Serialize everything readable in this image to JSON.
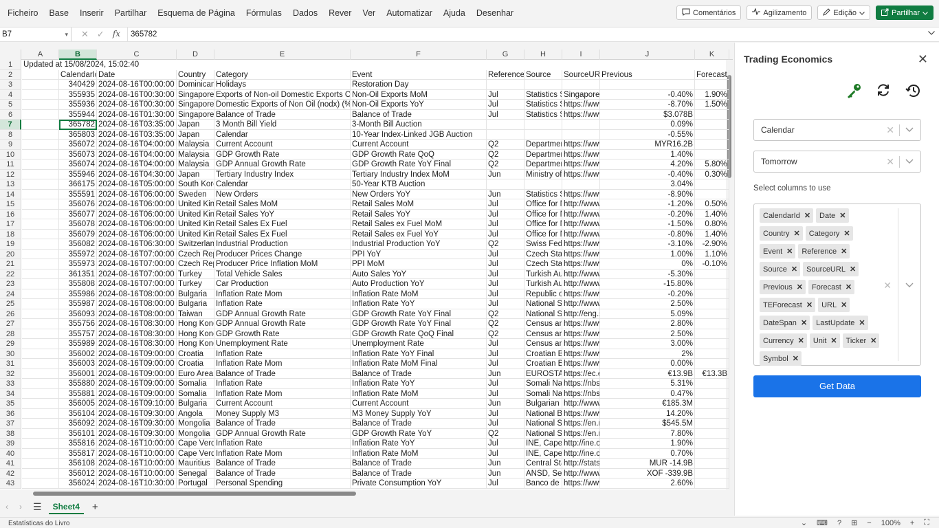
{
  "menu": [
    "Ficheiro",
    "Base",
    "Inserir",
    "Partilhar",
    "Esquema de Página",
    "Fórmulas",
    "Dados",
    "Rever",
    "Ver",
    "Automatizar",
    "Ajuda",
    "Desenhar"
  ],
  "toolbar": {
    "comments": "Comentários",
    "catchup": "Agilizamento",
    "editing": "Edição",
    "share": "Partilhar"
  },
  "formula": {
    "namebox": "B7",
    "value": "365782"
  },
  "columns": [
    "A",
    "B",
    "C",
    "D",
    "E",
    "F",
    "G",
    "H",
    "I",
    "J",
    "K"
  ],
  "title_row": "Updated at 15/08/2024, 15:02:40",
  "header_row": [
    "",
    "CalendarId",
    "Date",
    "Country",
    "Category",
    "Event",
    "Reference",
    "Source",
    "SourceURL",
    "Previous",
    "Forecast"
  ],
  "rows": [
    [
      "340429",
      "2024-08-16T00:00:00",
      "Dominican Republic",
      "Holidays",
      "Restoration Day",
      "",
      "",
      "",
      "",
      ""
    ],
    [
      "355935",
      "2024-08-16T00:30:00",
      "Singapore",
      "Exports of Non-oil Domestic Exports Oil",
      "Non-Oil Exports MoM",
      "Jul",
      "Statistics Singapore",
      "Singapore",
      "-0.40%",
      "1.90%"
    ],
    [
      "355936",
      "2024-08-16T00:30:00",
      "Singapore",
      "Domestic Exports of Non Oil (nodx) (% YoY)",
      "Non-Oil Exports YoY",
      "Jul",
      "Statistics Singapore",
      "https://www",
      "-8.70%",
      "1.50%"
    ],
    [
      "355944",
      "2024-08-16T01:30:00",
      "Singapore",
      "Balance of Trade",
      "Balance of Trade",
      "Jul",
      "Statistics Singapore",
      "https://www",
      "$3.078B",
      ""
    ],
    [
      "365782",
      "2024-08-16T03:35:00",
      "Japan",
      "3 Month Bill Yield",
      "3-Month Bill Auction",
      "",
      "",
      "",
      "0.09%",
      ""
    ],
    [
      "365803",
      "2024-08-16T03:35:00",
      "Japan",
      "Calendar",
      "10-Year Index-Linked JGB Auction",
      "",
      "",
      "",
      "-0.55%",
      ""
    ],
    [
      "356072",
      "2024-08-16T04:00:00",
      "Malaysia",
      "Current Account",
      "Current Account",
      "Q2",
      "Department",
      "https://www",
      "MYR16.2B",
      ""
    ],
    [
      "356073",
      "2024-08-16T04:00:00",
      "Malaysia",
      "GDP Growth Rate",
      "GDP Growth Rate QoQ",
      "Q2",
      "Department",
      "https://www",
      "1.40%",
      ""
    ],
    [
      "356074",
      "2024-08-16T04:00:00",
      "Malaysia",
      "GDP Annual Growth Rate",
      "GDP Growth Rate YoY Final",
      "Q2",
      "Department",
      "https://www",
      "4.20%",
      "5.80%"
    ],
    [
      "355946",
      "2024-08-16T04:30:00",
      "Japan",
      "Tertiary Industry Index",
      "Tertiary Industry Index MoM",
      "Jun",
      "Ministry of",
      "https://www",
      "-0.40%",
      "0.30%"
    ],
    [
      "366175",
      "2024-08-16T05:00:00",
      "South Korea",
      "Calendar",
      "50-Year KTB Auction",
      "",
      "",
      "",
      "3.04%",
      ""
    ],
    [
      "355591",
      "2024-08-16T06:00:00",
      "Sweden",
      "New Orders",
      "New Orders YoY",
      "Jun",
      "Statistics Sweden",
      "https://www",
      "-8.90%",
      ""
    ],
    [
      "356076",
      "2024-08-16T06:00:00",
      "United Kingdom",
      "Retail Sales MoM",
      "Retail Sales MoM",
      "Jul",
      "Office for National",
      "http://www",
      "-1.20%",
      "0.50%"
    ],
    [
      "356077",
      "2024-08-16T06:00:00",
      "United Kingdom",
      "Retail Sales YoY",
      "Retail Sales YoY",
      "Jul",
      "Office for National",
      "http://www",
      "-0.20%",
      "1.40%"
    ],
    [
      "356078",
      "2024-08-16T06:00:00",
      "United Kingdom",
      "Retail Sales Ex Fuel",
      "Retail Sales ex Fuel MoM",
      "Jul",
      "Office for National",
      "http://www",
      "-1.50%",
      "0.80%"
    ],
    [
      "356079",
      "2024-08-16T06:00:00",
      "United Kingdom",
      "Retail Sales Ex Fuel",
      "Retail Sales ex Fuel YoY",
      "Jul",
      "Office for National",
      "http://www",
      "-0.80%",
      "1.40%"
    ],
    [
      "356082",
      "2024-08-16T06:30:00",
      "Switzerland",
      "Industrial Production",
      "Industrial Production YoY",
      "Q2",
      "Swiss Federal",
      "https://www",
      "-3.10%",
      "-2.90%"
    ],
    [
      "355972",
      "2024-08-16T07:00:00",
      "Czech Republic",
      "Producer Prices Change",
      "PPI YoY",
      "Jul",
      "Czech Statistical",
      "https://www",
      "1.00%",
      "1.10%"
    ],
    [
      "355973",
      "2024-08-16T07:00:00",
      "Czech Republic",
      "Producer Price Inflation MoM",
      "PPI MoM",
      "Jul",
      "Czech Statistical",
      "https://www",
      "0%",
      "-0.10%"
    ],
    [
      "361351",
      "2024-08-16T07:00:00",
      "Turkey",
      "Total Vehicle Sales",
      "Auto Sales YoY",
      "Jul",
      "Turkish Automotive",
      "http://www",
      "-5.30%",
      ""
    ],
    [
      "355808",
      "2024-08-16T07:00:00",
      "Turkey",
      "Car Production",
      "Auto Production YoY",
      "Jul",
      "Turkish Automotive",
      "http://www",
      "-15.80%",
      ""
    ],
    [
      "355986",
      "2024-08-16T08:00:00",
      "Bulgaria",
      "Inflation Rate Mom",
      "Inflation Rate MoM",
      "Jul",
      "Republic of",
      "https://www",
      "-0.20%",
      ""
    ],
    [
      "355987",
      "2024-08-16T08:00:00",
      "Bulgaria",
      "Inflation Rate",
      "Inflation Rate YoY",
      "Jul",
      "National Statistical",
      "http://www",
      "2.50%",
      ""
    ],
    [
      "356093",
      "2024-08-16T08:00:00",
      "Taiwan",
      "GDP Annual Growth Rate",
      "GDP Growth Rate YoY Final",
      "Q2",
      "National Statistics",
      "http://eng.s",
      "5.09%",
      ""
    ],
    [
      "355756",
      "2024-08-16T08:30:00",
      "Hong Kong",
      "GDP Annual Growth Rate",
      "GDP Growth Rate YoY Final",
      "Q2",
      "Census and",
      "https://www",
      "2.80%",
      ""
    ],
    [
      "355757",
      "2024-08-16T08:30:00",
      "Hong Kong",
      "GDP Growth Rate",
      "GDP Growth Rate QoQ Final",
      "Q2",
      "Census and",
      "https://www",
      "2.50%",
      ""
    ],
    [
      "355989",
      "2024-08-16T08:30:00",
      "Hong Kong",
      "Unemployment Rate",
      "Unemployment Rate",
      "Jul",
      "Census and",
      "https://www",
      "3.00%",
      ""
    ],
    [
      "356002",
      "2024-08-16T09:00:00",
      "Croatia",
      "Inflation Rate",
      "Inflation Rate YoY Final",
      "Jul",
      "Croatian Bureau",
      "https://www",
      "2%",
      ""
    ],
    [
      "356003",
      "2024-08-16T09:00:00",
      "Croatia",
      "Inflation Rate Mom",
      "Inflation Rate MoM Final",
      "Jul",
      "Croatian Bureau",
      "https://www",
      "0.00%",
      ""
    ],
    [
      "356001",
      "2024-08-16T09:00:00",
      "Euro Area",
      "Balance of Trade",
      "Balance of Trade",
      "Jun",
      "EUROSTAT",
      "https://ec.e",
      "€13.9B",
      "€13.3B"
    ],
    [
      "355880",
      "2024-08-16T09:00:00",
      "Somalia",
      "Inflation Rate",
      "Inflation Rate YoY",
      "Jul",
      "Somali National",
      "https://nbs",
      "5.31%",
      ""
    ],
    [
      "355881",
      "2024-08-16T09:00:00",
      "Somalia",
      "Inflation Rate Mom",
      "Inflation Rate MoM",
      "Jul",
      "Somali National",
      "https://nbs",
      "0.47%",
      ""
    ],
    [
      "356005",
      "2024-08-16T09:10:00",
      "Bulgaria",
      "Current Account",
      "Current Account",
      "Jun",
      "Bulgarian",
      "http://www",
      "€185.3M",
      ""
    ],
    [
      "356104",
      "2024-08-16T09:30:00",
      "Angola",
      "Money Supply M3",
      "M3 Money Supply YoY",
      "Jul",
      "National Bank",
      "https://www",
      "14.20%",
      ""
    ],
    [
      "356092",
      "2024-08-16T09:30:00",
      "Mongolia",
      "Balance of Trade",
      "Balance of Trade",
      "Jul",
      "National Statistics",
      "https://en.n",
      "$545.5M",
      ""
    ],
    [
      "356101",
      "2024-08-16T09:30:00",
      "Mongolia",
      "GDP Annual Growth Rate",
      "GDP Growth Rate YoY",
      "Q2",
      "National Statistics",
      "https://en.n",
      "7.80%",
      ""
    ],
    [
      "355816",
      "2024-08-16T10:00:00",
      "Cape Verde",
      "Inflation Rate",
      "Inflation Rate YoY",
      "Jul",
      "INE, Cape",
      "http://ine.c",
      "1.90%",
      ""
    ],
    [
      "355817",
      "2024-08-16T10:00:00",
      "Cape Verde",
      "Inflation Rate Mom",
      "Inflation Rate MoM",
      "Jul",
      "INE, Cape",
      "http://ine.c",
      "0.70%",
      ""
    ],
    [
      "356108",
      "2024-08-16T10:00:00",
      "Mauritius",
      "Balance of Trade",
      "Balance of Trade",
      "Jun",
      "Central Statistics",
      "http://stats",
      "MUR -14.9B",
      ""
    ],
    [
      "356012",
      "2024-08-16T10:00:00",
      "Senegal",
      "Balance of Trade",
      "Balance of Trade",
      "Jun",
      "ANSD, Senegal",
      "http://www",
      "XOF -339.9B",
      ""
    ],
    [
      "356024",
      "2024-08-16T10:30:00",
      "Portugal",
      "Personal Spending",
      "Private Consumption YoY",
      "Jul",
      "Banco de",
      "https://www",
      "2.60%",
      ""
    ]
  ],
  "sheet": {
    "tab": "Sheet4"
  },
  "status": {
    "left": "Estatísticas do Livro",
    "zoom": "100%"
  },
  "pane": {
    "title": "Trading Economics",
    "dropdown1": "Calendar",
    "dropdown2": "Tomorrow",
    "columns_label": "Select columns to use",
    "chips": [
      "CalendarId",
      "Date",
      "Country",
      "Category",
      "Event",
      "Reference",
      "Source",
      "SourceURL",
      "Previous",
      "Forecast",
      "TEForecast",
      "URL",
      "DateSpan",
      "LastUpdate",
      "Currency",
      "Unit",
      "Ticker",
      "Symbol"
    ],
    "button": "Get Data"
  },
  "colors": {
    "excel_green": "#107c41",
    "action_blue": "#1a73e8",
    "key_green": "#1e7a26"
  }
}
